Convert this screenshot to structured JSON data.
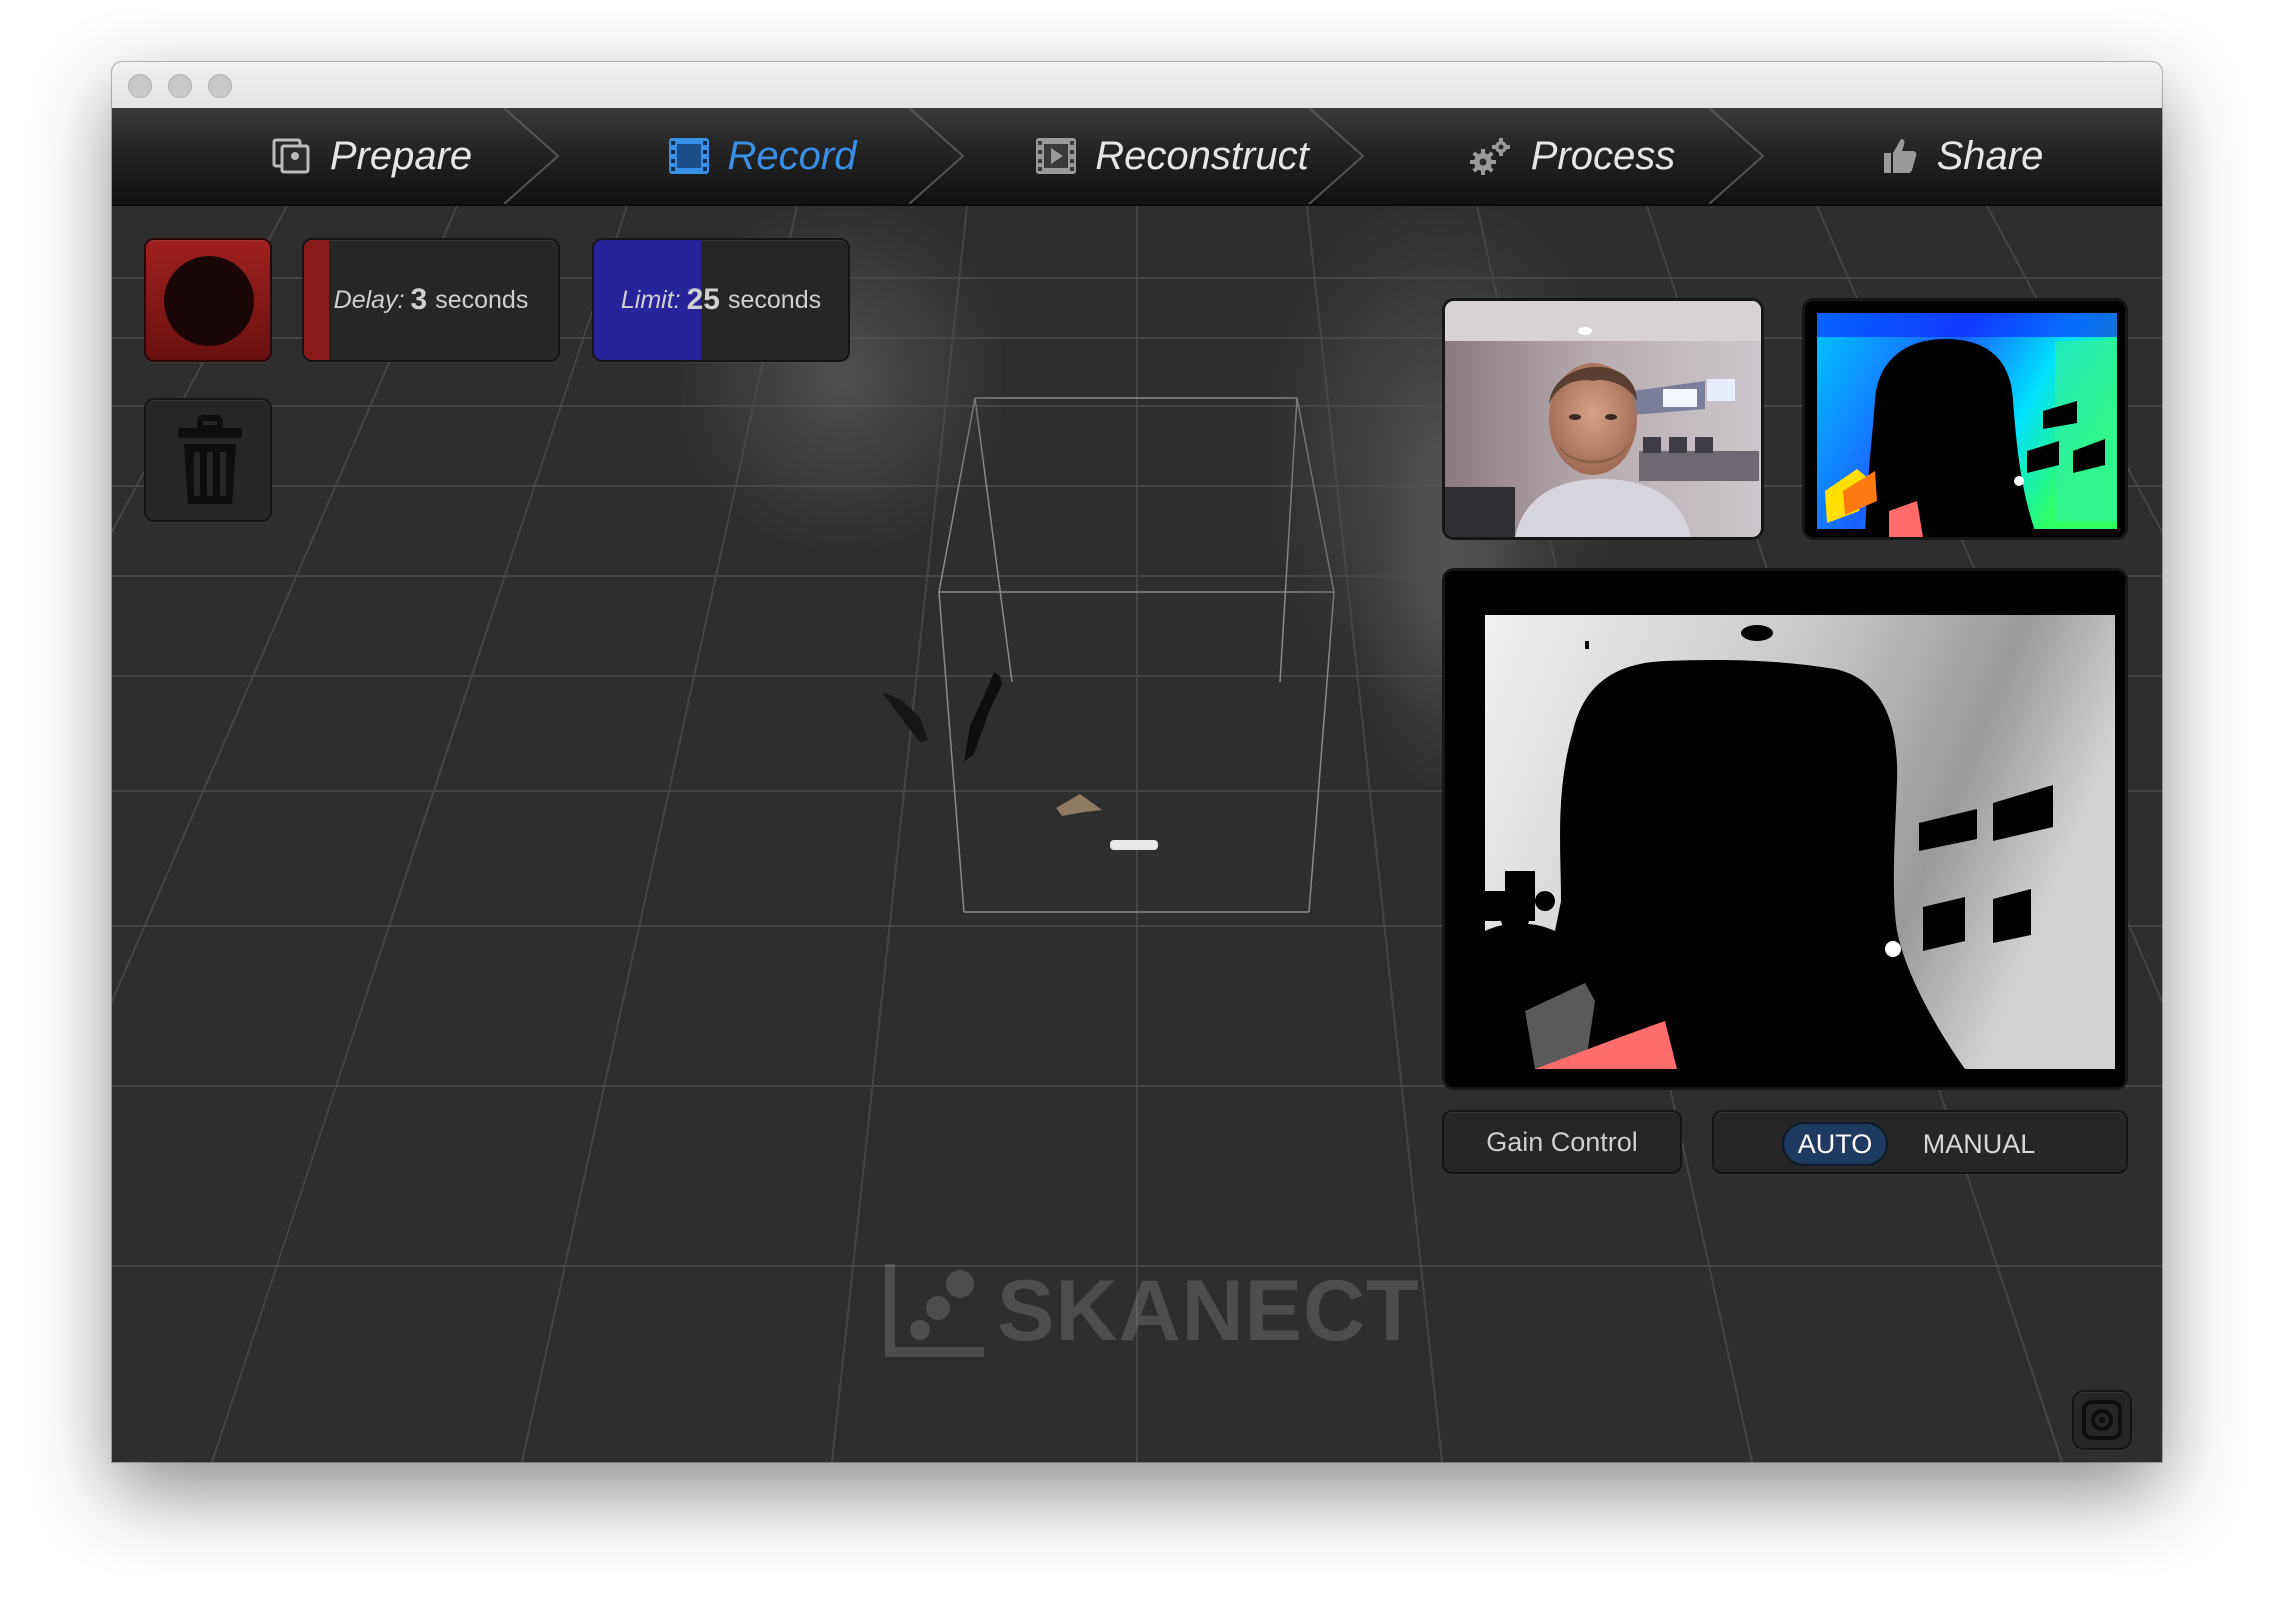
{
  "window": {
    "title": ""
  },
  "nav": {
    "steps": [
      {
        "label": "Prepare",
        "icon": "photos-icon",
        "active": false
      },
      {
        "label": "Record",
        "icon": "film-frame-icon",
        "active": true
      },
      {
        "label": "Reconstruct",
        "icon": "film-strip-icon",
        "active": false
      },
      {
        "label": "Process",
        "icon": "gears-icon",
        "active": false
      },
      {
        "label": "Share",
        "icon": "thumbs-up-icon",
        "active": false
      }
    ]
  },
  "controls": {
    "record_button": {
      "icon": "record-icon"
    },
    "delay": {
      "label": "Delay:",
      "value": "3",
      "unit": "seconds",
      "level": 0.1,
      "color": "#8a1a1a"
    },
    "limit": {
      "label": "Limit:",
      "value": "25",
      "unit": "seconds",
      "level": 0.42,
      "color": "#28239a"
    },
    "trash_button": {
      "icon": "trash-icon"
    }
  },
  "previews": {
    "rgb": "color-camera-preview",
    "depth_color": "depth-color-preview",
    "depth_gray": "depth-grayscale-preview"
  },
  "gain": {
    "label": "Gain Control",
    "options": [
      "AUTO",
      "MANUAL"
    ],
    "selected": "AUTO"
  },
  "logo": {
    "text": "SKANECT"
  },
  "screenshot_button": {
    "icon": "camera-snapshot-icon"
  },
  "colors": {
    "accent": "#3a8fe6",
    "auto_bg": "#1e3a5f"
  }
}
